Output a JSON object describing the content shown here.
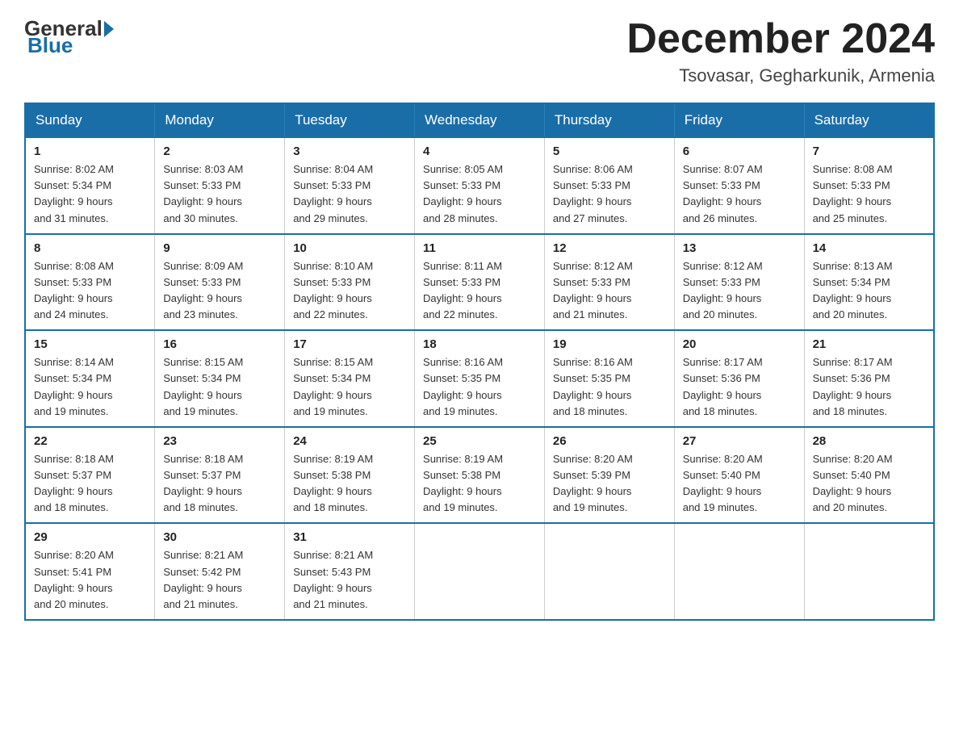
{
  "header": {
    "logo": {
      "general": "General",
      "blue": "Blue"
    },
    "title": "December 2024",
    "subtitle": "Tsovasar, Gegharkunik, Armenia"
  },
  "weekdays": [
    "Sunday",
    "Monday",
    "Tuesday",
    "Wednesday",
    "Thursday",
    "Friday",
    "Saturday"
  ],
  "weeks": [
    [
      {
        "day": "1",
        "sunrise": "Sunrise: 8:02 AM",
        "sunset": "Sunset: 5:34 PM",
        "daylight": "Daylight: 9 hours",
        "daylight2": "and 31 minutes."
      },
      {
        "day": "2",
        "sunrise": "Sunrise: 8:03 AM",
        "sunset": "Sunset: 5:33 PM",
        "daylight": "Daylight: 9 hours",
        "daylight2": "and 30 minutes."
      },
      {
        "day": "3",
        "sunrise": "Sunrise: 8:04 AM",
        "sunset": "Sunset: 5:33 PM",
        "daylight": "Daylight: 9 hours",
        "daylight2": "and 29 minutes."
      },
      {
        "day": "4",
        "sunrise": "Sunrise: 8:05 AM",
        "sunset": "Sunset: 5:33 PM",
        "daylight": "Daylight: 9 hours",
        "daylight2": "and 28 minutes."
      },
      {
        "day": "5",
        "sunrise": "Sunrise: 8:06 AM",
        "sunset": "Sunset: 5:33 PM",
        "daylight": "Daylight: 9 hours",
        "daylight2": "and 27 minutes."
      },
      {
        "day": "6",
        "sunrise": "Sunrise: 8:07 AM",
        "sunset": "Sunset: 5:33 PM",
        "daylight": "Daylight: 9 hours",
        "daylight2": "and 26 minutes."
      },
      {
        "day": "7",
        "sunrise": "Sunrise: 8:08 AM",
        "sunset": "Sunset: 5:33 PM",
        "daylight": "Daylight: 9 hours",
        "daylight2": "and 25 minutes."
      }
    ],
    [
      {
        "day": "8",
        "sunrise": "Sunrise: 8:08 AM",
        "sunset": "Sunset: 5:33 PM",
        "daylight": "Daylight: 9 hours",
        "daylight2": "and 24 minutes."
      },
      {
        "day": "9",
        "sunrise": "Sunrise: 8:09 AM",
        "sunset": "Sunset: 5:33 PM",
        "daylight": "Daylight: 9 hours",
        "daylight2": "and 23 minutes."
      },
      {
        "day": "10",
        "sunrise": "Sunrise: 8:10 AM",
        "sunset": "Sunset: 5:33 PM",
        "daylight": "Daylight: 9 hours",
        "daylight2": "and 22 minutes."
      },
      {
        "day": "11",
        "sunrise": "Sunrise: 8:11 AM",
        "sunset": "Sunset: 5:33 PM",
        "daylight": "Daylight: 9 hours",
        "daylight2": "and 22 minutes."
      },
      {
        "day": "12",
        "sunrise": "Sunrise: 8:12 AM",
        "sunset": "Sunset: 5:33 PM",
        "daylight": "Daylight: 9 hours",
        "daylight2": "and 21 minutes."
      },
      {
        "day": "13",
        "sunrise": "Sunrise: 8:12 AM",
        "sunset": "Sunset: 5:33 PM",
        "daylight": "Daylight: 9 hours",
        "daylight2": "and 20 minutes."
      },
      {
        "day": "14",
        "sunrise": "Sunrise: 8:13 AM",
        "sunset": "Sunset: 5:34 PM",
        "daylight": "Daylight: 9 hours",
        "daylight2": "and 20 minutes."
      }
    ],
    [
      {
        "day": "15",
        "sunrise": "Sunrise: 8:14 AM",
        "sunset": "Sunset: 5:34 PM",
        "daylight": "Daylight: 9 hours",
        "daylight2": "and 19 minutes."
      },
      {
        "day": "16",
        "sunrise": "Sunrise: 8:15 AM",
        "sunset": "Sunset: 5:34 PM",
        "daylight": "Daylight: 9 hours",
        "daylight2": "and 19 minutes."
      },
      {
        "day": "17",
        "sunrise": "Sunrise: 8:15 AM",
        "sunset": "Sunset: 5:34 PM",
        "daylight": "Daylight: 9 hours",
        "daylight2": "and 19 minutes."
      },
      {
        "day": "18",
        "sunrise": "Sunrise: 8:16 AM",
        "sunset": "Sunset: 5:35 PM",
        "daylight": "Daylight: 9 hours",
        "daylight2": "and 19 minutes."
      },
      {
        "day": "19",
        "sunrise": "Sunrise: 8:16 AM",
        "sunset": "Sunset: 5:35 PM",
        "daylight": "Daylight: 9 hours",
        "daylight2": "and 18 minutes."
      },
      {
        "day": "20",
        "sunrise": "Sunrise: 8:17 AM",
        "sunset": "Sunset: 5:36 PM",
        "daylight": "Daylight: 9 hours",
        "daylight2": "and 18 minutes."
      },
      {
        "day": "21",
        "sunrise": "Sunrise: 8:17 AM",
        "sunset": "Sunset: 5:36 PM",
        "daylight": "Daylight: 9 hours",
        "daylight2": "and 18 minutes."
      }
    ],
    [
      {
        "day": "22",
        "sunrise": "Sunrise: 8:18 AM",
        "sunset": "Sunset: 5:37 PM",
        "daylight": "Daylight: 9 hours",
        "daylight2": "and 18 minutes."
      },
      {
        "day": "23",
        "sunrise": "Sunrise: 8:18 AM",
        "sunset": "Sunset: 5:37 PM",
        "daylight": "Daylight: 9 hours",
        "daylight2": "and 18 minutes."
      },
      {
        "day": "24",
        "sunrise": "Sunrise: 8:19 AM",
        "sunset": "Sunset: 5:38 PM",
        "daylight": "Daylight: 9 hours",
        "daylight2": "and 18 minutes."
      },
      {
        "day": "25",
        "sunrise": "Sunrise: 8:19 AM",
        "sunset": "Sunset: 5:38 PM",
        "daylight": "Daylight: 9 hours",
        "daylight2": "and 19 minutes."
      },
      {
        "day": "26",
        "sunrise": "Sunrise: 8:20 AM",
        "sunset": "Sunset: 5:39 PM",
        "daylight": "Daylight: 9 hours",
        "daylight2": "and 19 minutes."
      },
      {
        "day": "27",
        "sunrise": "Sunrise: 8:20 AM",
        "sunset": "Sunset: 5:40 PM",
        "daylight": "Daylight: 9 hours",
        "daylight2": "and 19 minutes."
      },
      {
        "day": "28",
        "sunrise": "Sunrise: 8:20 AM",
        "sunset": "Sunset: 5:40 PM",
        "daylight": "Daylight: 9 hours",
        "daylight2": "and 20 minutes."
      }
    ],
    [
      {
        "day": "29",
        "sunrise": "Sunrise: 8:20 AM",
        "sunset": "Sunset: 5:41 PM",
        "daylight": "Daylight: 9 hours",
        "daylight2": "and 20 minutes."
      },
      {
        "day": "30",
        "sunrise": "Sunrise: 8:21 AM",
        "sunset": "Sunset: 5:42 PM",
        "daylight": "Daylight: 9 hours",
        "daylight2": "and 21 minutes."
      },
      {
        "day": "31",
        "sunrise": "Sunrise: 8:21 AM",
        "sunset": "Sunset: 5:43 PM",
        "daylight": "Daylight: 9 hours",
        "daylight2": "and 21 minutes."
      },
      null,
      null,
      null,
      null
    ]
  ]
}
